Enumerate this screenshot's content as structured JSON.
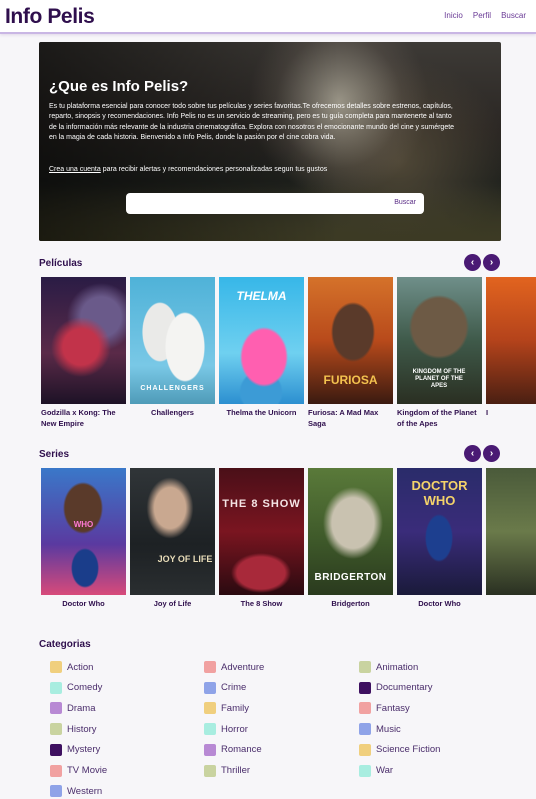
{
  "header": {
    "brand": "Info Pelis",
    "nav": [
      "Inicio",
      "Perfil",
      "Buscar"
    ]
  },
  "hero": {
    "title": "¿Que es Info Pelis?",
    "description": "Es tu plataforma esencial para conocer todo sobre tus películas y series favoritas.Te ofrecemos detalles sobre estrenos, capítulos, reparto, sinopsis y recomendaciones. Info Pelis no es un servicio de streaming, pero es tu guía completa para mantenerte al tanto de la información más relevante de la industria cinematográfica. Explora con nosotros el emocionante mundo del cine y sumérgete en la magia de cada historia. Bienvenido a Info Pelis, donde la pasión por el cine cobra vida.",
    "cta_link": "Crea una cuenta",
    "cta_rest": " para recibir alertas y recomendaciones personalizadas segun tus gustos",
    "search_placeholder": "",
    "search_button": "Buscar"
  },
  "movies": {
    "title": "Películas",
    "items": [
      {
        "title": "Godzilla x Kong: The New Empire",
        "poster_text": ""
      },
      {
        "title": "Challengers",
        "poster_text": "CHALLENGERS"
      },
      {
        "title": "Thelma the Unicorn",
        "poster_text": "THELMA"
      },
      {
        "title": "Furiosa: A Mad Max Saga",
        "poster_text": "FURIOSA"
      },
      {
        "title": "Kingdom of the Planet of the Apes",
        "poster_text": "KINGDOM OF THE PLANET OF THE APES"
      },
      {
        "title": "I",
        "poster_text": ""
      }
    ]
  },
  "series": {
    "title": "Series",
    "items": [
      {
        "title": "Doctor Who",
        "poster_text": "WHO"
      },
      {
        "title": "Joy of Life",
        "poster_text": "JOY OF LIFE"
      },
      {
        "title": "The 8 Show",
        "poster_text": "THE 8 SHOW"
      },
      {
        "title": "Bridgerton",
        "poster_text": "BRIDGERTON"
      },
      {
        "title": "Doctor Who",
        "poster_text": "DOCTOR WHO"
      }
    ]
  },
  "categories": {
    "title": "Categorias",
    "items": [
      {
        "label": "Action",
        "color": "#f0cf7e"
      },
      {
        "label": "Adventure",
        "color": "#f1a1a1"
      },
      {
        "label": "Animation",
        "color": "#c9d3a0"
      },
      {
        "label": "Comedy",
        "color": "#a8ede0"
      },
      {
        "label": "Crime",
        "color": "#8fa3e8"
      },
      {
        "label": "Documentary",
        "color": "#3e1060"
      },
      {
        "label": "Drama",
        "color": "#b889d4"
      },
      {
        "label": "Family",
        "color": "#f0cf7e"
      },
      {
        "label": "Fantasy",
        "color": "#f1a1a1"
      },
      {
        "label": "History",
        "color": "#c9d3a0"
      },
      {
        "label": "Horror",
        "color": "#a8ede0"
      },
      {
        "label": "Music",
        "color": "#8fa3e8"
      },
      {
        "label": "Mystery",
        "color": "#3e1060"
      },
      {
        "label": "Romance",
        "color": "#b889d4"
      },
      {
        "label": "Science Fiction",
        "color": "#f0cf7e"
      },
      {
        "label": "TV Movie",
        "color": "#f1a1a1"
      },
      {
        "label": "Thriller",
        "color": "#c9d3a0"
      },
      {
        "label": "War",
        "color": "#a8ede0"
      },
      {
        "label": "Western",
        "color": "#8fa3e8"
      }
    ]
  }
}
